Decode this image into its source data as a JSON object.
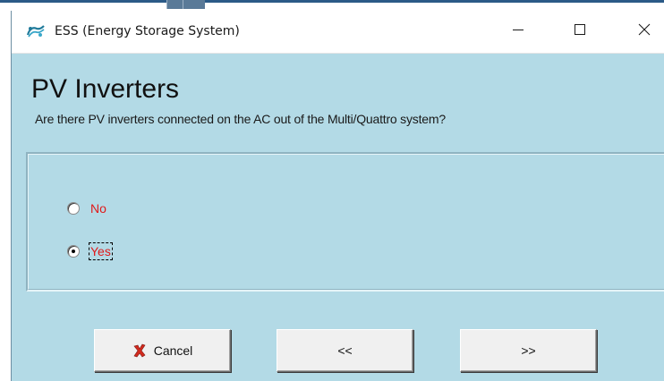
{
  "window": {
    "title": "ESS (Energy Storage System)",
    "controls": {
      "minimize_icon": "minimize-icon",
      "maximize_icon": "maximize-icon",
      "close_icon": "close-icon"
    }
  },
  "page": {
    "heading": "PV Inverters",
    "question": "Are there PV inverters connected on the AC out of the Multi/Quattro system?"
  },
  "options": [
    {
      "label": "No",
      "selected": false
    },
    {
      "label": "Yes",
      "selected": true,
      "focused": true
    }
  ],
  "buttons": {
    "cancel": "Cancel",
    "back": "<<",
    "next": ">>"
  },
  "colors": {
    "dialog_background": "#b3dae6",
    "option_text": "#e01a1a",
    "cancel_icon": "#d22a1e"
  }
}
